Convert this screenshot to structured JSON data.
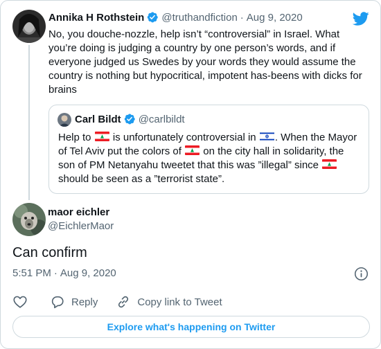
{
  "colors": {
    "twitter_blue": "#1d9bf0",
    "text_primary": "#0f1419",
    "text_secondary": "#536471",
    "border": "#cfd9de"
  },
  "icons": {
    "logo": "twitter-bird-icon",
    "verified": "verified-badge-icon",
    "info": "info-icon",
    "like": "heart-icon",
    "reply": "reply-bubble-icon",
    "copy_link": "link-icon",
    "flags": [
      "lebanon-flag-icon",
      "israel-flag-icon"
    ]
  },
  "parent_tweet": {
    "display_name": "Annika H Rothstein",
    "handle": "@truthandfiction",
    "separator": "·",
    "date": "Aug 9, 2020",
    "text": "No, you douche-nozzle, help isn’t “controversial” in Israel. What you’re doing is judging a country by one person’s words, and if everyone judged us Swedes by your words they would assume the country is nothing but hypocritical, impotent has-beens with dicks for brains"
  },
  "quoted_tweet": {
    "display_name": "Carl Bildt",
    "handle": "@carlbildt",
    "text_parts": [
      "Help to",
      "is unfortunately controversial in",
      ". When the Mayor of Tel Aviv put the colors of",
      "on the city hall in solidarity, the son of PM Netanyahu tweetet that this was ”illegal” since",
      "should be seen as a ”terrorist state”."
    ]
  },
  "main_tweet": {
    "display_name": "maor eichler",
    "handle": "@EichlerMaor",
    "text": "Can confirm",
    "time": "5:51 PM",
    "separator": "·",
    "date": "Aug 9, 2020"
  },
  "actions": {
    "reply_label": "Reply",
    "copy_link_label": "Copy link to Tweet"
  },
  "explore_label": "Explore what's happening on Twitter"
}
